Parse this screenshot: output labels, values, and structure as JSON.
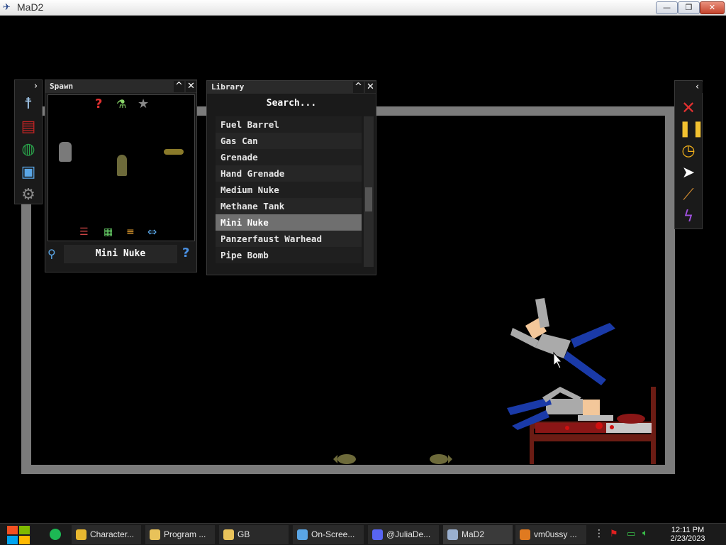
{
  "window": {
    "title": "MaD2"
  },
  "spawn": {
    "header": "Spawn",
    "selected_name": "Mini Nuke"
  },
  "library": {
    "header": "Library",
    "search_placeholder": "Search...",
    "items": [
      "Fuel Barrel",
      "Gas Can",
      "Grenade",
      "Hand Grenade",
      "Medium Nuke",
      "Methane Tank",
      "Mini Nuke",
      "Panzerfaust Warhead",
      "Pipe Bomb"
    ],
    "selected_index": 6
  },
  "taskbar": {
    "items": [
      {
        "label": "Character...",
        "icon": "chrome-icon"
      },
      {
        "label": "Program ...",
        "icon": "folder-icon"
      },
      {
        "label": "GB",
        "icon": "folder-icon"
      },
      {
        "label": "On-Scree...",
        "icon": "keyboard-icon"
      },
      {
        "label": "@JuliaDe...",
        "icon": "discord-icon"
      },
      {
        "label": "MaD2",
        "icon": "mad2-icon"
      },
      {
        "label": "vm0ussy ...",
        "icon": "app-icon"
      }
    ],
    "time": "12:11 PM",
    "date": "2/23/2023"
  },
  "colors": {
    "arena": "#7b7b7b",
    "selected_item": "#6f6f6f",
    "ragdoll_shirt": "#aaaaaa",
    "ragdoll_pants": "#1a3aa8",
    "bed": "#6b1c14"
  }
}
